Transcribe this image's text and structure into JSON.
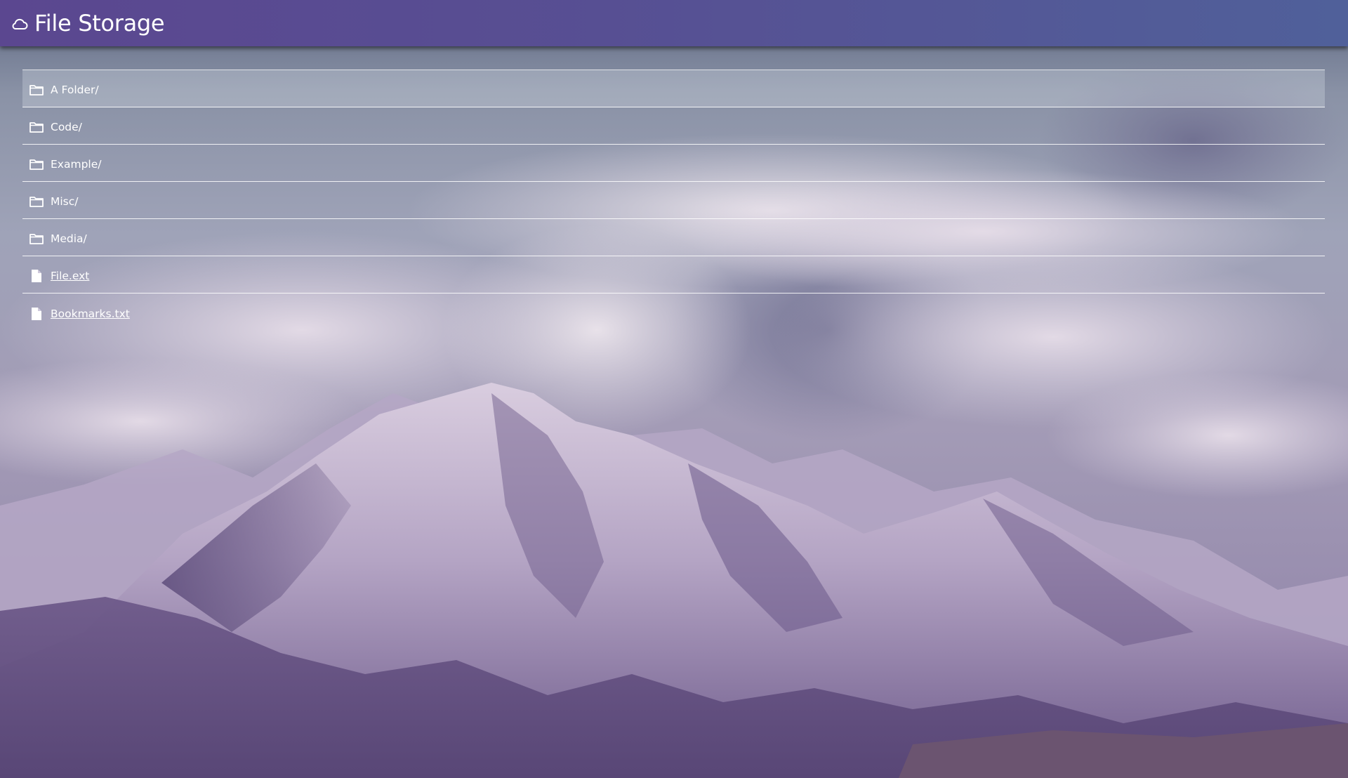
{
  "header": {
    "title": "File Storage",
    "icon": "cloud-icon",
    "gradient": [
      "#5b4790",
      "#50609a"
    ]
  },
  "entries": [
    {
      "name": "A Folder/",
      "type": "folder",
      "icon": "folder-icon"
    },
    {
      "name": "Code/",
      "type": "folder",
      "icon": "folder-icon"
    },
    {
      "name": "Example/",
      "type": "folder",
      "icon": "folder-icon"
    },
    {
      "name": "Misc/",
      "type": "folder",
      "icon": "folder-icon"
    },
    {
      "name": "Media/",
      "type": "folder",
      "icon": "folder-icon"
    },
    {
      "name": "File.ext",
      "type": "file",
      "icon": "file-icon"
    },
    {
      "name": "Bookmarks.txt",
      "type": "file",
      "icon": "file-icon"
    }
  ],
  "background": {
    "subject": "snow-covered mountains under clouds",
    "tint": "#7a7499"
  }
}
